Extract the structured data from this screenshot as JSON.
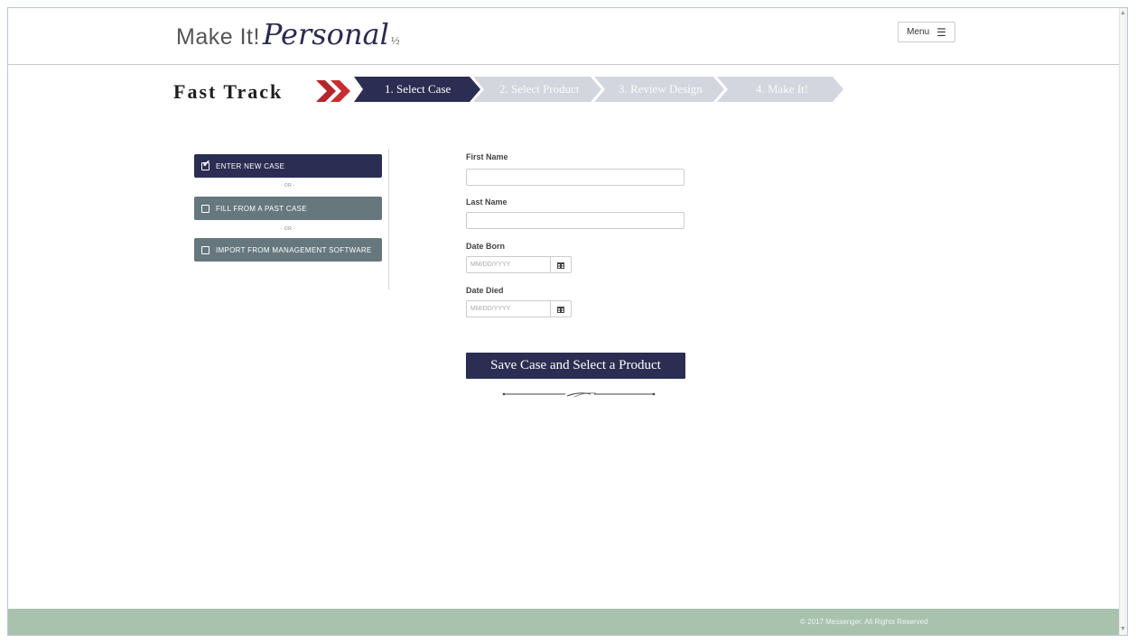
{
  "header": {
    "logo_main": "Make It!",
    "logo_script": "Personal",
    "logo_suffix": "½",
    "menu_label": "Menu"
  },
  "fast_track": {
    "title": "Fast Track",
    "steps": [
      {
        "label": "1. Select Case",
        "active": true
      },
      {
        "label": "2. Select Product",
        "active": false
      },
      {
        "label": "3. Review Design",
        "active": false
      },
      {
        "label": "4. Make It!",
        "active": false
      }
    ]
  },
  "case_options": {
    "items": [
      {
        "label": "ENTER NEW CASE",
        "checked": true
      },
      {
        "label": "FILL FROM A PAST CASE",
        "checked": false
      },
      {
        "label": "IMPORT FROM MANAGEMENT SOFTWARE",
        "checked": false
      }
    ],
    "separator": "- OR -"
  },
  "form": {
    "first_name_label": "First Name",
    "first_name_value": "",
    "last_name_label": "Last Name",
    "last_name_value": "",
    "date_born_label": "Date Born",
    "date_born_placeholder": "MM/DD/YYYY",
    "date_died_label": "Date Died",
    "date_died_placeholder": "MM/DD/YYYY",
    "submit_label": "Save Case and Select a Product"
  },
  "footer": {
    "copyright": "© 2017 Messenger. All Rights Reserved"
  },
  "colors": {
    "navy": "#2b2d52",
    "slate": "#66777e",
    "step_inactive": "#d3d6de",
    "chevron_red": "#b4262b",
    "footer": "#a9c2ae"
  },
  "icons": [
    "hamburger-icon",
    "calendar-icon",
    "checkbox-checked-icon",
    "checkbox-icon",
    "chevron-double-icon"
  ]
}
